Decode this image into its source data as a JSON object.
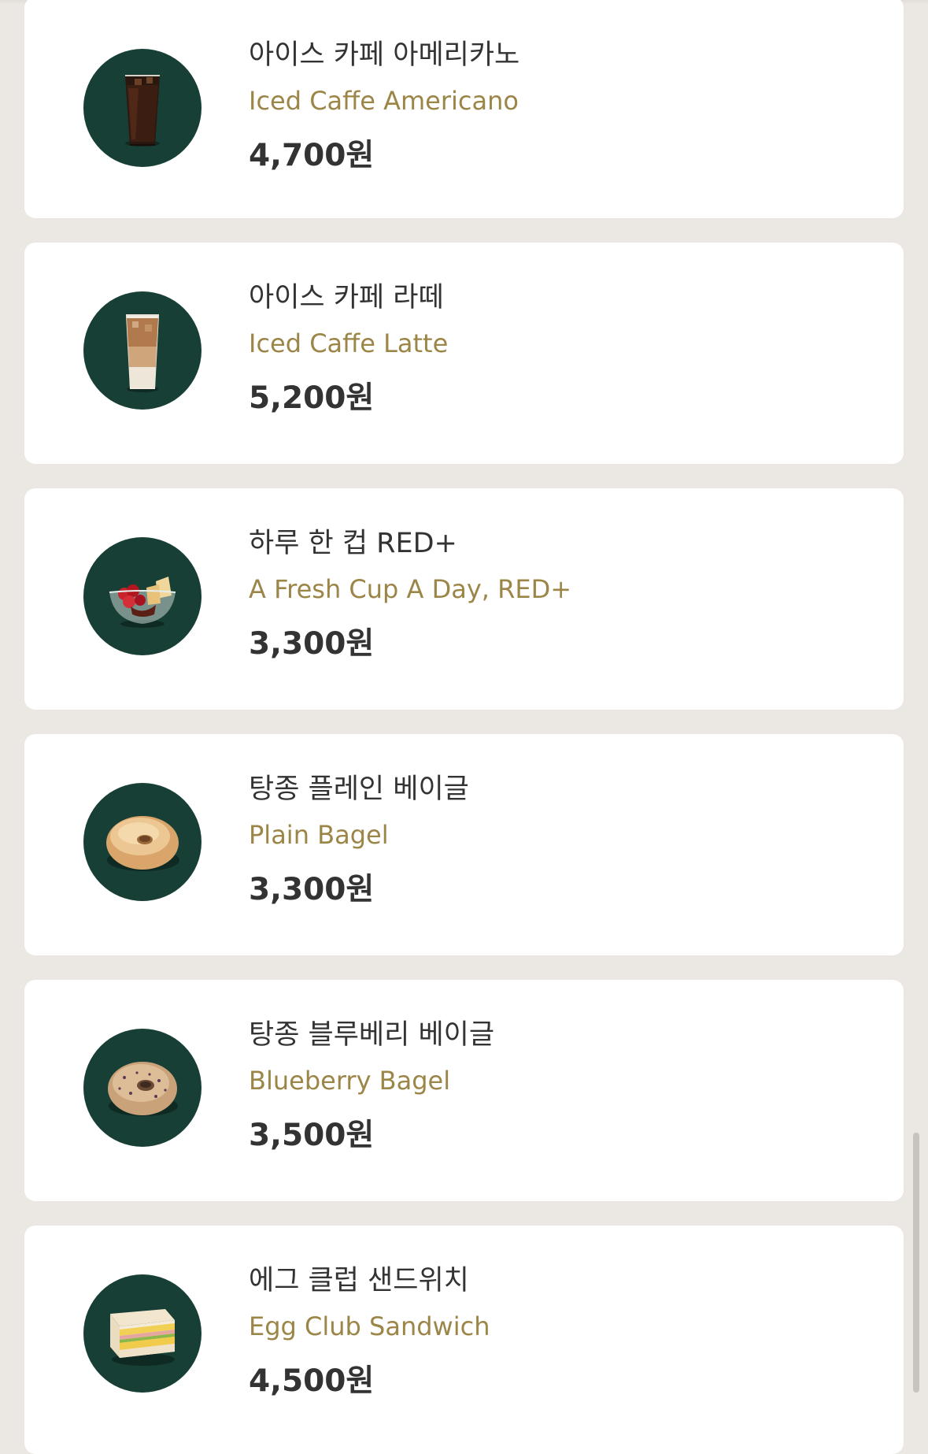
{
  "menu": {
    "items": [
      {
        "name_ko": "아이스 카페 아메리카노",
        "name_en": "Iced Caffe Americano",
        "price": "4,700원",
        "image": "iced-americano-icon"
      },
      {
        "name_ko": "아이스 카페 라떼",
        "name_en": "Iced Caffe Latte",
        "price": "5,200원",
        "image": "iced-latte-icon"
      },
      {
        "name_ko": "하루 한 컵 RED+",
        "name_en": "A Fresh Cup A Day, RED+",
        "price": "3,300원",
        "image": "fruit-cup-icon"
      },
      {
        "name_ko": "탕종 플레인 베이글",
        "name_en": "Plain Bagel",
        "price": "3,300원",
        "image": "plain-bagel-icon"
      },
      {
        "name_ko": "탕종 블루베리 베이글",
        "name_en": "Blueberry Bagel",
        "price": "3,500원",
        "image": "blueberry-bagel-icon"
      },
      {
        "name_ko": "에그 클럽 샌드위치",
        "name_en": "Egg Club Sandwich",
        "price": "4,500원",
        "image": "sandwich-icon"
      }
    ]
  },
  "colors": {
    "background": "#ebe7e3",
    "card": "#ffffff",
    "thumb_bg": "#173f35",
    "english_name": "#9b8547",
    "text": "#333333"
  }
}
